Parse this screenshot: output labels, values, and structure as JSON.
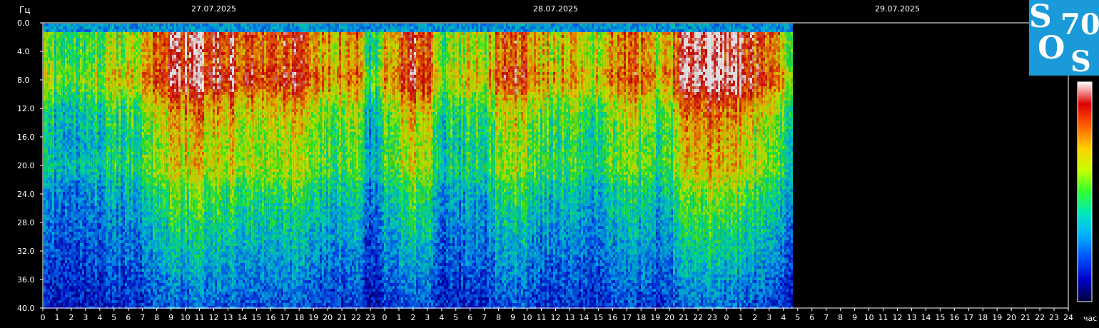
{
  "chart_data": {
    "type": "heatmap",
    "title": "",
    "ylabel": "Гц",
    "xlabel": "час",
    "ylim": [
      0,
      40
    ],
    "y_ticks": [
      "0.0",
      "4.0",
      "8.0",
      "12.0",
      "16.0",
      "20.0",
      "24.0",
      "28.0",
      "32.0",
      "36.0",
      "40.0"
    ],
    "y_tick_values": [
      0,
      4,
      8,
      12,
      16,
      20,
      24,
      28,
      32,
      36,
      40
    ],
    "x_range_hours": [
      0,
      72
    ],
    "x_ticks": [
      "0",
      "1",
      "2",
      "3",
      "4",
      "5",
      "6",
      "7",
      "8",
      "9",
      "10",
      "11",
      "12",
      "13",
      "14",
      "15",
      "16",
      "17",
      "18",
      "19",
      "20",
      "21",
      "22",
      "23",
      "0",
      "1",
      "2",
      "3",
      "4",
      "5",
      "6",
      "7",
      "8",
      "9",
      "10",
      "11",
      "12",
      "13",
      "14",
      "15",
      "16",
      "17",
      "18",
      "19",
      "20",
      "21",
      "22",
      "23",
      "0",
      "1",
      "2",
      "3",
      "4",
      "5",
      "6",
      "7",
      "8",
      "9",
      "10",
      "11",
      "12",
      "13",
      "14",
      "15",
      "16",
      "17",
      "18",
      "19",
      "20",
      "21",
      "22",
      "23",
      "24"
    ],
    "dates": [
      "27.07.2025",
      "28.07.2025",
      "29.07.2025"
    ],
    "date_positions_hours": [
      12,
      36,
      60
    ],
    "data_end_hour": 52.6,
    "colormap": [
      "#00003a",
      "#0000c8",
      "#0050ff",
      "#00b0ff",
      "#00e8c0",
      "#30ff30",
      "#c8ff00",
      "#ffd000",
      "#ff6000",
      "#e00000",
      "#ffffff"
    ],
    "intensity_profile": [
      {
        "h": 0,
        "i": 0.55
      },
      {
        "h": 1,
        "i": 0.45
      },
      {
        "h": 2,
        "i": 0.5
      },
      {
        "h": 3,
        "i": 0.45
      },
      {
        "h": 4,
        "i": 0.5
      },
      {
        "h": 5,
        "i": 0.58
      },
      {
        "h": 6,
        "i": 0.62
      },
      {
        "h": 7,
        "i": 0.62
      },
      {
        "h": 8,
        "i": 0.8
      },
      {
        "h": 9,
        "i": 0.88
      },
      {
        "h": 10,
        "i": 0.92
      },
      {
        "h": 11,
        "i": 0.9
      },
      {
        "h": 12,
        "i": 0.86
      },
      {
        "h": 13,
        "i": 0.88
      },
      {
        "h": 14,
        "i": 0.85
      },
      {
        "h": 15,
        "i": 0.86
      },
      {
        "h": 16,
        "i": 0.84
      },
      {
        "h": 17,
        "i": 0.84
      },
      {
        "h": 18,
        "i": 0.82
      },
      {
        "h": 19,
        "i": 0.7
      },
      {
        "h": 20,
        "i": 0.72
      },
      {
        "h": 21,
        "i": 0.68
      },
      {
        "h": 22,
        "i": 0.7
      },
      {
        "h": 23,
        "i": 0.35
      },
      {
        "h": 24,
        "i": 0.72
      },
      {
        "h": 25,
        "i": 0.8
      },
      {
        "h": 26,
        "i": 0.84
      },
      {
        "h": 27,
        "i": 0.78
      },
      {
        "h": 28,
        "i": 0.55
      },
      {
        "h": 29,
        "i": 0.6
      },
      {
        "h": 30,
        "i": 0.62
      },
      {
        "h": 31,
        "i": 0.6
      },
      {
        "h": 32,
        "i": 0.8
      },
      {
        "h": 33,
        "i": 0.84
      },
      {
        "h": 34,
        "i": 0.78
      },
      {
        "h": 35,
        "i": 0.68
      },
      {
        "h": 36,
        "i": 0.66
      },
      {
        "h": 37,
        "i": 0.62
      },
      {
        "h": 38,
        "i": 0.6
      },
      {
        "h": 39,
        "i": 0.6
      },
      {
        "h": 40,
        "i": 0.75
      },
      {
        "h": 41,
        "i": 0.78
      },
      {
        "h": 42,
        "i": 0.72
      },
      {
        "h": 43,
        "i": 0.6
      },
      {
        "h": 44,
        "i": 0.66
      },
      {
        "h": 45,
        "i": 1.0
      },
      {
        "h": 46,
        "i": 1.0
      },
      {
        "h": 47,
        "i": 0.98
      },
      {
        "h": 48,
        "i": 0.95
      },
      {
        "h": 49,
        "i": 0.9
      },
      {
        "h": 50,
        "i": 0.82
      },
      {
        "h": 51,
        "i": 0.74
      },
      {
        "h": 52,
        "i": 0.6
      },
      {
        "h": 52.6,
        "i": 0.5
      }
    ]
  },
  "logo": {
    "line1": "S",
    "line2": "70",
    "line3": "O",
    "line4": "S",
    "bg": "#1a9ad8"
  }
}
